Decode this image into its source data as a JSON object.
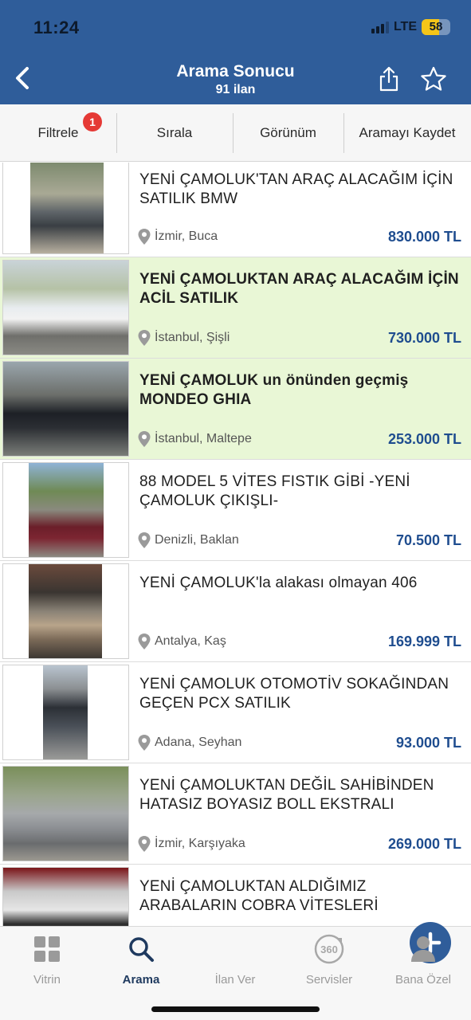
{
  "status_bar": {
    "time": "11:24",
    "network": "LTE",
    "battery": "58"
  },
  "nav": {
    "title": "Arama Sonucu",
    "subtitle": "91 ilan"
  },
  "toolbar": {
    "filter_label": "Filtrele",
    "filter_badge": "1",
    "sort_label": "Sırala",
    "view_label": "Görünüm",
    "save_search_label": "Aramayı Kaydet"
  },
  "listings": [
    {
      "title": "YENİ ÇAMOLUK'TAN ARAÇ ALACAĞIM İÇİN SATILIK BMW",
      "location": "İzmir, Buca",
      "price": "830.000 TL",
      "highlighted": false
    },
    {
      "title": "YENİ ÇAMOLUKTAN ARAÇ ALACAĞIM İÇİN ACİL SATILIK",
      "location": "İstanbul, Şişli",
      "price": "730.000 TL",
      "highlighted": true
    },
    {
      "title": "YENİ ÇAMOLUK un önünden geçmiş MONDEO GHIA",
      "location": "İstanbul, Maltepe",
      "price": "253.000 TL",
      "highlighted": true
    },
    {
      "title": "88 MODEL 5 VİTES FISTIK GİBİ -YENİ ÇAMOLUK ÇIKIŞLI-",
      "location": "Denizli, Baklan",
      "price": "70.500 TL",
      "highlighted": false
    },
    {
      "title": "YENİ ÇAMOLUK'la alakası olmayan 406",
      "location": "Antalya, Kaş",
      "price": "169.999 TL",
      "highlighted": false
    },
    {
      "title": "YENİ ÇAMOLUK OTOMOTİV SOKAĞINDAN GEÇEN PCX SATILIK",
      "location": "Adana, Seyhan",
      "price": "93.000 TL",
      "highlighted": false
    },
    {
      "title": "YENİ ÇAMOLUKTAN DEĞİL SAHİBİNDEN HATASIZ BOYASIZ BOLL EKSTRALI",
      "location": "İzmir, Karşıyaka",
      "price": "269.000 TL",
      "highlighted": false
    },
    {
      "title": "YENİ ÇAMOLUKTAN ALDIĞIMIZ ARABALARIN COBRA VİTESLERİ",
      "location": "",
      "price": "",
      "highlighted": false
    }
  ],
  "tabbar": {
    "showcase": "Vitrin",
    "search": "Arama",
    "post_ad": "İlan Ver",
    "services": "Servisler",
    "profile": "Bana Özel"
  },
  "colors": {
    "brand": "#2f5d9a",
    "highlight_row": "#e9f7d6",
    "price": "#1f4d8f",
    "badge": "#e53935"
  }
}
